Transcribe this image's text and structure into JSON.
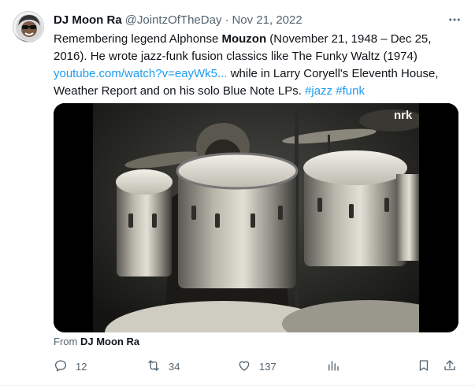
{
  "tweet": {
    "author": {
      "display_name": "DJ Moon Ra",
      "handle": "@JointzOfTheDay"
    },
    "separator": "·",
    "date": "Nov 21, 2022",
    "text": {
      "p1": "Remembering legend Alphonse ",
      "bold": "Mouzon",
      "p2": " (November 21, 1948 – Dec 25, 2016). He wrote jazz-funk fusion classics like The Funky Waltz (1974) ",
      "link": "youtube.com/watch?v=eayWk5...",
      "p3": " while in Larry Coryell's Eleventh House, Weather Report and on his solo Blue Note LPs. ",
      "hashtags": [
        "#jazz",
        "#funk"
      ]
    },
    "media": {
      "watermark": "nrk",
      "icon": "video-thumbnail"
    },
    "from_label": "From",
    "from_name": "DJ Moon Ra",
    "actions": {
      "replies": "12",
      "reposts": "34",
      "likes": "137"
    },
    "colors": {
      "link": "#1d9bf0",
      "secondary_text": "#536471",
      "primary_text": "#0f1419"
    }
  }
}
